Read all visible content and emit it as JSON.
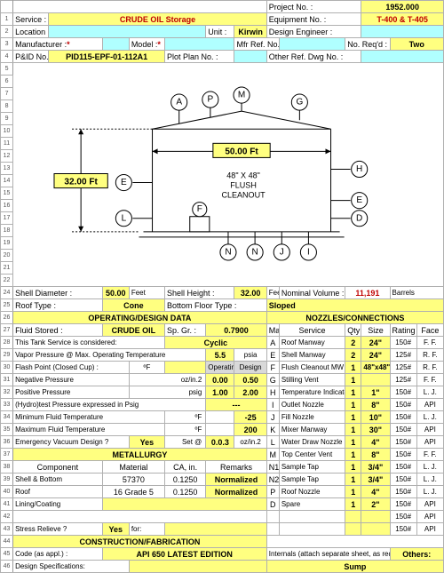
{
  "project_no_label": "Project No. :",
  "project_no": "1952.000",
  "service_label": "Service :",
  "service": "CRUDE OIL Storage",
  "equipment_no_label": "Equipment No. :",
  "equipment_no": "T-400 & T-405",
  "location_label": "Location :",
  "unit_label": "Unit :",
  "unit": "Kirwin",
  "design_eng_label": "Design Engineer :",
  "manufacturer_label": "Manufacturer :",
  "model_label": "Model :",
  "mfr_ref_label": "Mfr Ref. No. :",
  "no_reqd_label": "No. Req'd :",
  "no_reqd": "Two",
  "pid_label": "P&ID No. :",
  "pid": "PID115-EPF-01-112A1",
  "plotplan_label": "Plot Plan No. :",
  "other_ref_label": "Other Ref. Dwg No. :",
  "diagram": {
    "height_label": "32.00 Ft",
    "width_label": "50.00 Ft",
    "cleanout": "48\" X 48\"\nFLUSH\nCLEANOUT",
    "nodes": [
      "A",
      "P",
      "M",
      "G",
      "E",
      "H",
      "E",
      "L",
      "F",
      "N",
      "N",
      "J",
      "I",
      "D"
    ]
  },
  "shell_dia_label": "Shell Diameter :",
  "shell_dia": "50.00",
  "shell_dia_unit": "Feet",
  "shell_h_label": "Shell Height :",
  "shell_h": "32.00",
  "shell_h_unit": "Feet",
  "nom_vol_label": "Nominal Volume :",
  "nom_vol": "11,191",
  "nom_vol_unit": "Barrels",
  "roof_type_label": "Roof Type :",
  "roof_type": "Cone",
  "bottom_floor_label": "Bottom Floor Type :",
  "bottom_floor": "Sloped",
  "band_op": "OPERATING/DESIGN DATA",
  "band_noz": "NOZZLES/CONNECTIONS",
  "fluid_label": "Fluid Stored :",
  "fluid": "CRUDE OIL",
  "spgr_label": "Sp. Gr. :",
  "spgr": "0.7900",
  "col_mark": "Mark",
  "col_service": "Service",
  "col_qty": "Qty",
  "col_size": "Size",
  "col_rating": "Rating",
  "col_face": "Face",
  "r28": {
    "left": "This Tank Service is considered:",
    "val": "Cyclic"
  },
  "r29": {
    "left": "Vapor Pressure @ Max. Operating Temperature",
    "v": "5.5",
    "u": "psia"
  },
  "r30": {
    "left": "Flash Point (Closed Cup) :",
    "u": "ºF",
    "op": "Operating",
    "de": "Design"
  },
  "r31": {
    "left": "Negative Pressure",
    "u": "oz/in.2",
    "op": "0.00",
    "de": "0.50"
  },
  "r32": {
    "left": "Positive Pressure",
    "u": "psig",
    "op": "1.00",
    "de": "2.00"
  },
  "r33": {
    "left": "(Hydro)test Pressure expressed in Psig",
    "v": "---"
  },
  "r34": {
    "left": "Minimum Fluid Temperature",
    "u": "ºF",
    "v": "-25"
  },
  "r35": {
    "left": "Maximum Fluid Temperature",
    "u": "ºF",
    "v": "200"
  },
  "r36": {
    "left": "Emergency Vacuum Design ?",
    "yes": "Yes",
    "set": "Set @",
    "v": "0.0.3",
    "u": "oz/in.2"
  },
  "met_band": "METALLURGY",
  "met_hdr": {
    "c1": "Component",
    "c2": "Material",
    "c3": "CA, in.",
    "c4": "Remarks"
  },
  "r39": {
    "c1": "Shell & Bottom",
    "c2": "57370",
    "c3": "0.1250",
    "c4": "Normalized"
  },
  "r40": {
    "c1": "Roof",
    "c2": "16 Grade 5",
    "c3": "0.1250",
    "c4": "Normalized"
  },
  "r41": {
    "c1": "Lining/Coating"
  },
  "r43": {
    "c1": "Stress Relieve ?",
    "c2": "Yes",
    "c3": "for:"
  },
  "con_band": "CONSTRUCTION/FABRICATION",
  "r45": {
    "left": "Code (as appl.) :",
    "v": "API 650 LATEST EDITION",
    "right": "Internals (attach separate sheet, as req'd):",
    "oth": "Others:"
  },
  "r46": {
    "left": "Design Specifications:",
    "right": "Sump"
  },
  "noz": [
    {
      "m": "A",
      "s": "Roof Manway",
      "q": "2",
      "sz": "24\"",
      "r": "150#",
      "f": "F. F."
    },
    {
      "m": "E",
      "s": "Shell Manway",
      "q": "2",
      "sz": "24\"",
      "r": "125#",
      "f": "R. F."
    },
    {
      "m": "F",
      "s": "Flush Cleanout MW",
      "q": "1",
      "sz": "48\"x48\"",
      "r": "125#",
      "f": "R. F."
    },
    {
      "m": "G",
      "s": "Stilling Vent",
      "q": "1",
      "sz": "",
      "r": "125#",
      "f": "F. F."
    },
    {
      "m": "H",
      "s": "Temperature Indicator",
      "q": "1",
      "sz": "1\"",
      "r": "150#",
      "f": "L. J."
    },
    {
      "m": "I",
      "s": "Outlet Nozzle",
      "q": "1",
      "sz": "8\"",
      "r": "150#",
      "f": "API"
    },
    {
      "m": "J",
      "s": "Fill Nozzle",
      "q": "1",
      "sz": "10\"",
      "r": "150#",
      "f": "L. J."
    },
    {
      "m": "K",
      "s": "Mixer Manway",
      "q": "1",
      "sz": "30\"",
      "r": "150#",
      "f": "API"
    },
    {
      "m": "L",
      "s": "Water Draw Nozzle",
      "q": "1",
      "sz": "4\"",
      "r": "150#",
      "f": "API"
    },
    {
      "m": "M",
      "s": "Top Center Vent",
      "q": "1",
      "sz": "8\"",
      "r": "150#",
      "f": "F. F."
    },
    {
      "m": "N1",
      "s": "Sample Tap",
      "q": "1",
      "sz": "3/4\"",
      "r": "150#",
      "f": "L. J."
    },
    {
      "m": "N2",
      "s": "Sample Tap",
      "q": "1",
      "sz": "3/4\"",
      "r": "150#",
      "f": "L. J."
    },
    {
      "m": "P",
      "s": "Roof Nozzle",
      "q": "1",
      "sz": "4\"",
      "r": "150#",
      "f": "L. J."
    },
    {
      "m": "D",
      "s": "Spare",
      "q": "1",
      "sz": "2\"",
      "r": "150#",
      "f": "API"
    },
    {
      "m": "",
      "s": "",
      "q": "",
      "sz": "",
      "r": "150#",
      "f": "API"
    },
    {
      "m": "",
      "s": "",
      "q": "",
      "sz": "",
      "r": "150#",
      "f": "API"
    }
  ]
}
